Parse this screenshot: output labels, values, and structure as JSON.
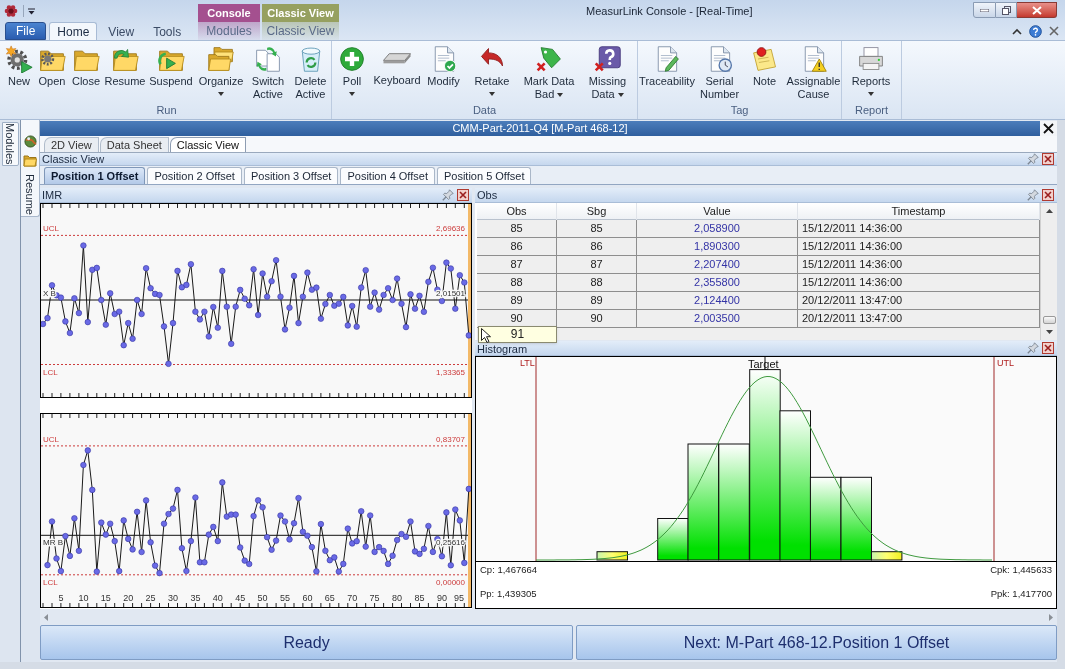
{
  "window": {
    "title": "MeasurLink Console - [Real-Time]"
  },
  "ribbon_tabs": [
    {
      "label": "File",
      "kind": "file",
      "selected": false
    },
    {
      "label": "Home",
      "kind": "tab",
      "selected": true
    },
    {
      "label": "View",
      "kind": "tab",
      "selected": false
    },
    {
      "label": "Tools",
      "kind": "tab",
      "selected": false
    }
  ],
  "contextual_tabs": [
    {
      "label": "Console",
      "color": "#a4508f",
      "tabs": [
        {
          "label": "Modules",
          "selected": false
        }
      ]
    },
    {
      "label": "Classic View",
      "color": "#96a060",
      "tabs": [
        {
          "label": "Classic View",
          "selected": false
        }
      ]
    }
  ],
  "ribbon_groups": [
    {
      "label": "Run",
      "buttons": [
        {
          "label": "New"
        },
        {
          "label": "Open"
        },
        {
          "label": "Close"
        },
        {
          "label": "Resume"
        },
        {
          "label": "Suspend"
        },
        {
          "label": "Organize",
          "dropdown": true
        },
        {
          "label": "Switch Active"
        },
        {
          "label": "Delete Active"
        }
      ]
    },
    {
      "label": "Data",
      "buttons": [
        {
          "label": "Poll",
          "dropdown": true
        },
        {
          "label": "Keyboard"
        },
        {
          "label": "Modify"
        },
        {
          "label": "Retake",
          "dropdown": true
        },
        {
          "label": "Mark Data Bad",
          "dropdown": true
        },
        {
          "label": "Missing Data",
          "dropdown": true
        }
      ]
    },
    {
      "label": "Tag",
      "buttons": [
        {
          "label": "Traceability"
        },
        {
          "label": "Serial Number"
        },
        {
          "label": "Note"
        },
        {
          "label": "Assignable Cause"
        }
      ]
    },
    {
      "label": "Report",
      "buttons": [
        {
          "label": "Reports",
          "dropdown": true
        }
      ]
    }
  ],
  "side_tabs": [
    {
      "label": "Modules"
    },
    {
      "label": "Resume"
    }
  ],
  "document": {
    "title": "CMM-Part-2011-Q4 [M-Part 468-12]",
    "view_tabs": [
      {
        "label": "2D View",
        "selected": false
      },
      {
        "label": "Data Sheet",
        "selected": false
      },
      {
        "label": "Classic View",
        "selected": true
      }
    ],
    "view_panel": {
      "title": "Classic View",
      "position_tabs": [
        {
          "label": "Position 1 Offset",
          "selected": true
        },
        {
          "label": "Position 2 Offset",
          "selected": false
        },
        {
          "label": "Position 3 Offset",
          "selected": false
        },
        {
          "label": "Position 4 Offset",
          "selected": false
        },
        {
          "label": "Position 5 Offset",
          "selected": false
        }
      ]
    }
  },
  "imr_panel": {
    "title": "IMR",
    "charts": [
      {
        "limit_labels": [
          {
            "label": "UCL",
            "value": "2,69636"
          },
          {
            "label": "X B",
            "value": "2,01501"
          },
          {
            "label": "LCL",
            "value": "1,33365"
          }
        ]
      },
      {
        "limit_labels": [
          {
            "label": "UCL",
            "value": "0,83707"
          },
          {
            "label": "MR B",
            "value": "0,25616"
          },
          {
            "label": "LCL",
            "value": "0,00000"
          }
        ],
        "x_axis_labels": [
          "5",
          "10",
          "15",
          "20",
          "25",
          "30",
          "35",
          "40",
          "45",
          "50",
          "55",
          "60",
          "65",
          "70",
          "75",
          "80",
          "85",
          "90",
          "95"
        ]
      }
    ]
  },
  "obs_panel": {
    "title": "Obs",
    "columns": [
      "Obs",
      "Sbg",
      "Value",
      "Timestamp"
    ],
    "rows": [
      [
        "85",
        "85",
        "2,058900",
        "15/12/2011 14:36:00"
      ],
      [
        "86",
        "86",
        "1,890300",
        "15/12/2011 14:36:00"
      ],
      [
        "87",
        "87",
        "2,207400",
        "15/12/2011 14:36:00"
      ],
      [
        "88",
        "88",
        "2,355800",
        "15/12/2011 14:36:00"
      ],
      [
        "89",
        "89",
        "2,124400",
        "20/12/2011 13:47:00"
      ],
      [
        "90",
        "90",
        "2,003500",
        "20/12/2011 13:47:00"
      ]
    ]
  },
  "tooltip": {
    "text": "91"
  },
  "histogram_panel": {
    "title": "Histogram",
    "lower_limit_label": "LTL",
    "upper_limit_label": "UTL",
    "target_label": "Target",
    "stats_left": [
      "Cp: 1,467664",
      "Pp: 1,439305"
    ],
    "stats_right": [
      "Cpk: 1,445633",
      "Ppk: 1,417700"
    ]
  },
  "status_bar": {
    "left": "Ready",
    "right": "Next: M-Part 468-12.Position 1 Offset"
  }
}
